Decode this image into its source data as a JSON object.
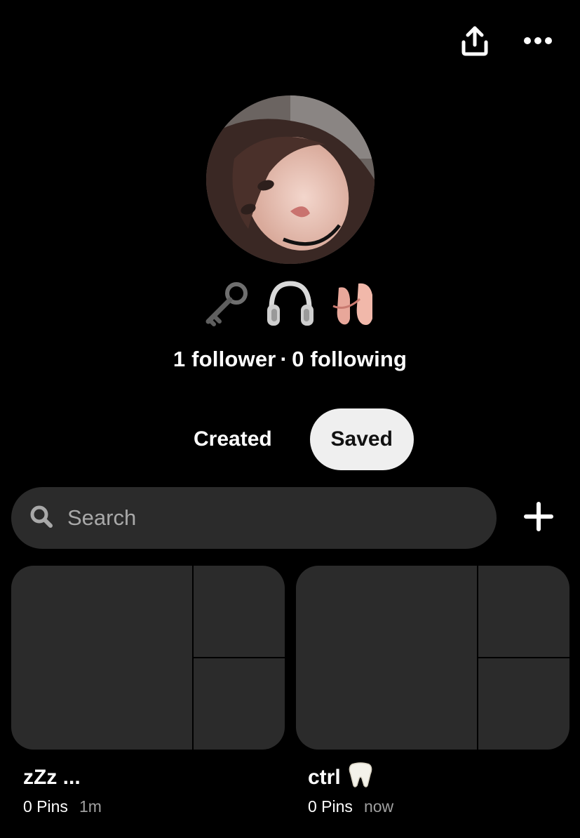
{
  "header": {
    "share_icon": "share-upload-icon",
    "more_icon": "more-dots-icon"
  },
  "profile": {
    "emojis": [
      "old-key-emoji",
      "headphones-emoji",
      "ballet-shoes-emoji"
    ],
    "stats": {
      "followers": "1 follower",
      "separator": "·",
      "following": "0 following"
    }
  },
  "tabs": {
    "created": "Created",
    "saved": "Saved",
    "active": "Saved"
  },
  "search": {
    "placeholder": "Search",
    "value": "",
    "icon": "search-icon"
  },
  "add_icon": "plus-icon",
  "boards": [
    {
      "title": "zZz ...",
      "emoji": "",
      "pins": "0 Pins",
      "time": "1m"
    },
    {
      "title": "ctrl",
      "emoji": "tooth-emoji",
      "pins": "0 Pins",
      "time": "now"
    }
  ],
  "colors": {
    "background": "#000000",
    "surface": "#2b2b2b",
    "active_tab_bg": "#efefef",
    "muted_text": "#a0a0a0"
  }
}
